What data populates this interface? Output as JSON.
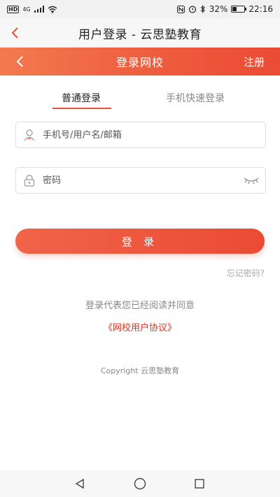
{
  "status_bar": {
    "hd": "HD",
    "network": "4G",
    "battery": "32%",
    "time": "22:16"
  },
  "titlebar": {
    "title": "用户登录 - 云思塾教育",
    "back_icon": "chevron-left-icon"
  },
  "header": {
    "title": "登录网校",
    "register_label": "注册",
    "back_icon": "chevron-left-icon"
  },
  "tabs": [
    {
      "label": "普通登录",
      "active": true
    },
    {
      "label": "手机快速登录",
      "active": false
    }
  ],
  "form": {
    "username_placeholder": "手机号/用户名/邮箱",
    "password_placeholder": "密码",
    "login_label": "登 录",
    "forgot_label": "忘记密码?"
  },
  "agreement": {
    "text": "登录代表您已经阅读并同意",
    "link": "《网校用户协议》"
  },
  "copyright": "Copyright 云思塾教育",
  "colors": {
    "accent": "#ea4b33",
    "header_start": "#f27a4e",
    "link": "#d6321f"
  }
}
